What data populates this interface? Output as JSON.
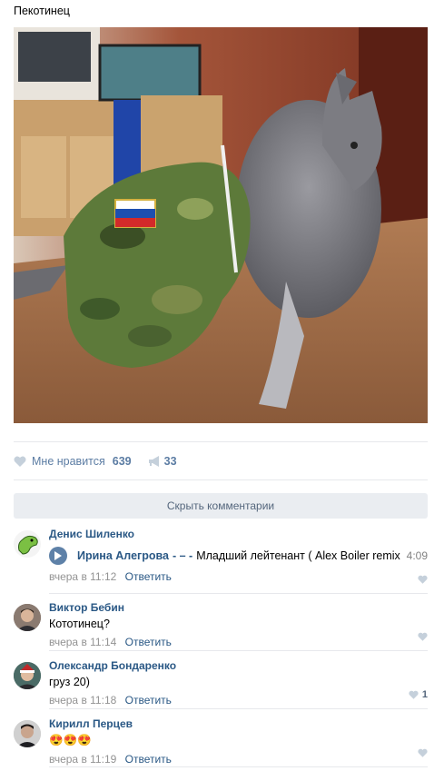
{
  "post": {
    "text": "Пекотинец",
    "likes_label": "Мне нравится",
    "likes_count": "639",
    "shares_count": "33"
  },
  "hide_comments_label": "Скрыть комментарии",
  "comments": [
    {
      "author": "Денис Шиленко",
      "audio_artist": "Ирина Алегрова",
      "audio_dash": "- – -",
      "audio_title": "Младший лейтенант ( Alex Boiler remix",
      "audio_duration": "4:09",
      "time": "вчера в 11:12",
      "reply": "Ответить",
      "likes": ""
    },
    {
      "author": "Виктор Бебин",
      "text": "Кототинец?",
      "time": "вчера в 11:14",
      "reply": "Ответить",
      "likes": ""
    },
    {
      "author": "Олександр Бондаренко",
      "text": "груз 20)",
      "time": "вчера в 11:18",
      "reply": "Ответить",
      "likes": "1"
    },
    {
      "author": "Кирилл Перцев",
      "text": "😍😍😍",
      "time": "вчера в 11:19",
      "reply": "Ответить",
      "likes": ""
    }
  ],
  "colors": {
    "link": "#2a5885",
    "meta": "#939393",
    "accent": "#5e81a8"
  }
}
